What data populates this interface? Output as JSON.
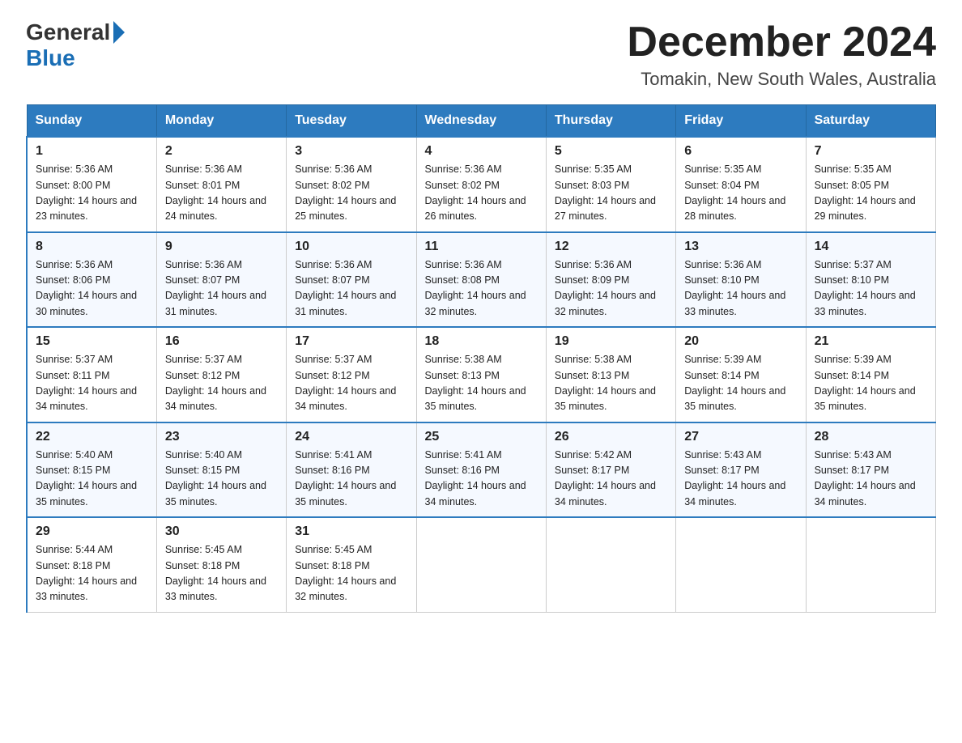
{
  "header": {
    "logo_general": "General",
    "logo_blue": "Blue",
    "month": "December 2024",
    "location": "Tomakin, New South Wales, Australia"
  },
  "columns": [
    "Sunday",
    "Monday",
    "Tuesday",
    "Wednesday",
    "Thursday",
    "Friday",
    "Saturday"
  ],
  "weeks": [
    [
      {
        "day": "1",
        "sunrise": "Sunrise: 5:36 AM",
        "sunset": "Sunset: 8:00 PM",
        "daylight": "Daylight: 14 hours and 23 minutes."
      },
      {
        "day": "2",
        "sunrise": "Sunrise: 5:36 AM",
        "sunset": "Sunset: 8:01 PM",
        "daylight": "Daylight: 14 hours and 24 minutes."
      },
      {
        "day": "3",
        "sunrise": "Sunrise: 5:36 AM",
        "sunset": "Sunset: 8:02 PM",
        "daylight": "Daylight: 14 hours and 25 minutes."
      },
      {
        "day": "4",
        "sunrise": "Sunrise: 5:36 AM",
        "sunset": "Sunset: 8:02 PM",
        "daylight": "Daylight: 14 hours and 26 minutes."
      },
      {
        "day": "5",
        "sunrise": "Sunrise: 5:35 AM",
        "sunset": "Sunset: 8:03 PM",
        "daylight": "Daylight: 14 hours and 27 minutes."
      },
      {
        "day": "6",
        "sunrise": "Sunrise: 5:35 AM",
        "sunset": "Sunset: 8:04 PM",
        "daylight": "Daylight: 14 hours and 28 minutes."
      },
      {
        "day": "7",
        "sunrise": "Sunrise: 5:35 AM",
        "sunset": "Sunset: 8:05 PM",
        "daylight": "Daylight: 14 hours and 29 minutes."
      }
    ],
    [
      {
        "day": "8",
        "sunrise": "Sunrise: 5:36 AM",
        "sunset": "Sunset: 8:06 PM",
        "daylight": "Daylight: 14 hours and 30 minutes."
      },
      {
        "day": "9",
        "sunrise": "Sunrise: 5:36 AM",
        "sunset": "Sunset: 8:07 PM",
        "daylight": "Daylight: 14 hours and 31 minutes."
      },
      {
        "day": "10",
        "sunrise": "Sunrise: 5:36 AM",
        "sunset": "Sunset: 8:07 PM",
        "daylight": "Daylight: 14 hours and 31 minutes."
      },
      {
        "day": "11",
        "sunrise": "Sunrise: 5:36 AM",
        "sunset": "Sunset: 8:08 PM",
        "daylight": "Daylight: 14 hours and 32 minutes."
      },
      {
        "day": "12",
        "sunrise": "Sunrise: 5:36 AM",
        "sunset": "Sunset: 8:09 PM",
        "daylight": "Daylight: 14 hours and 32 minutes."
      },
      {
        "day": "13",
        "sunrise": "Sunrise: 5:36 AM",
        "sunset": "Sunset: 8:10 PM",
        "daylight": "Daylight: 14 hours and 33 minutes."
      },
      {
        "day": "14",
        "sunrise": "Sunrise: 5:37 AM",
        "sunset": "Sunset: 8:10 PM",
        "daylight": "Daylight: 14 hours and 33 minutes."
      }
    ],
    [
      {
        "day": "15",
        "sunrise": "Sunrise: 5:37 AM",
        "sunset": "Sunset: 8:11 PM",
        "daylight": "Daylight: 14 hours and 34 minutes."
      },
      {
        "day": "16",
        "sunrise": "Sunrise: 5:37 AM",
        "sunset": "Sunset: 8:12 PM",
        "daylight": "Daylight: 14 hours and 34 minutes."
      },
      {
        "day": "17",
        "sunrise": "Sunrise: 5:37 AM",
        "sunset": "Sunset: 8:12 PM",
        "daylight": "Daylight: 14 hours and 34 minutes."
      },
      {
        "day": "18",
        "sunrise": "Sunrise: 5:38 AM",
        "sunset": "Sunset: 8:13 PM",
        "daylight": "Daylight: 14 hours and 35 minutes."
      },
      {
        "day": "19",
        "sunrise": "Sunrise: 5:38 AM",
        "sunset": "Sunset: 8:13 PM",
        "daylight": "Daylight: 14 hours and 35 minutes."
      },
      {
        "day": "20",
        "sunrise": "Sunrise: 5:39 AM",
        "sunset": "Sunset: 8:14 PM",
        "daylight": "Daylight: 14 hours and 35 minutes."
      },
      {
        "day": "21",
        "sunrise": "Sunrise: 5:39 AM",
        "sunset": "Sunset: 8:14 PM",
        "daylight": "Daylight: 14 hours and 35 minutes."
      }
    ],
    [
      {
        "day": "22",
        "sunrise": "Sunrise: 5:40 AM",
        "sunset": "Sunset: 8:15 PM",
        "daylight": "Daylight: 14 hours and 35 minutes."
      },
      {
        "day": "23",
        "sunrise": "Sunrise: 5:40 AM",
        "sunset": "Sunset: 8:15 PM",
        "daylight": "Daylight: 14 hours and 35 minutes."
      },
      {
        "day": "24",
        "sunrise": "Sunrise: 5:41 AM",
        "sunset": "Sunset: 8:16 PM",
        "daylight": "Daylight: 14 hours and 35 minutes."
      },
      {
        "day": "25",
        "sunrise": "Sunrise: 5:41 AM",
        "sunset": "Sunset: 8:16 PM",
        "daylight": "Daylight: 14 hours and 34 minutes."
      },
      {
        "day": "26",
        "sunrise": "Sunrise: 5:42 AM",
        "sunset": "Sunset: 8:17 PM",
        "daylight": "Daylight: 14 hours and 34 minutes."
      },
      {
        "day": "27",
        "sunrise": "Sunrise: 5:43 AM",
        "sunset": "Sunset: 8:17 PM",
        "daylight": "Daylight: 14 hours and 34 minutes."
      },
      {
        "day": "28",
        "sunrise": "Sunrise: 5:43 AM",
        "sunset": "Sunset: 8:17 PM",
        "daylight": "Daylight: 14 hours and 34 minutes."
      }
    ],
    [
      {
        "day": "29",
        "sunrise": "Sunrise: 5:44 AM",
        "sunset": "Sunset: 8:18 PM",
        "daylight": "Daylight: 14 hours and 33 minutes."
      },
      {
        "day": "30",
        "sunrise": "Sunrise: 5:45 AM",
        "sunset": "Sunset: 8:18 PM",
        "daylight": "Daylight: 14 hours and 33 minutes."
      },
      {
        "day": "31",
        "sunrise": "Sunrise: 5:45 AM",
        "sunset": "Sunset: 8:18 PM",
        "daylight": "Daylight: 14 hours and 32 minutes."
      },
      null,
      null,
      null,
      null
    ]
  ]
}
